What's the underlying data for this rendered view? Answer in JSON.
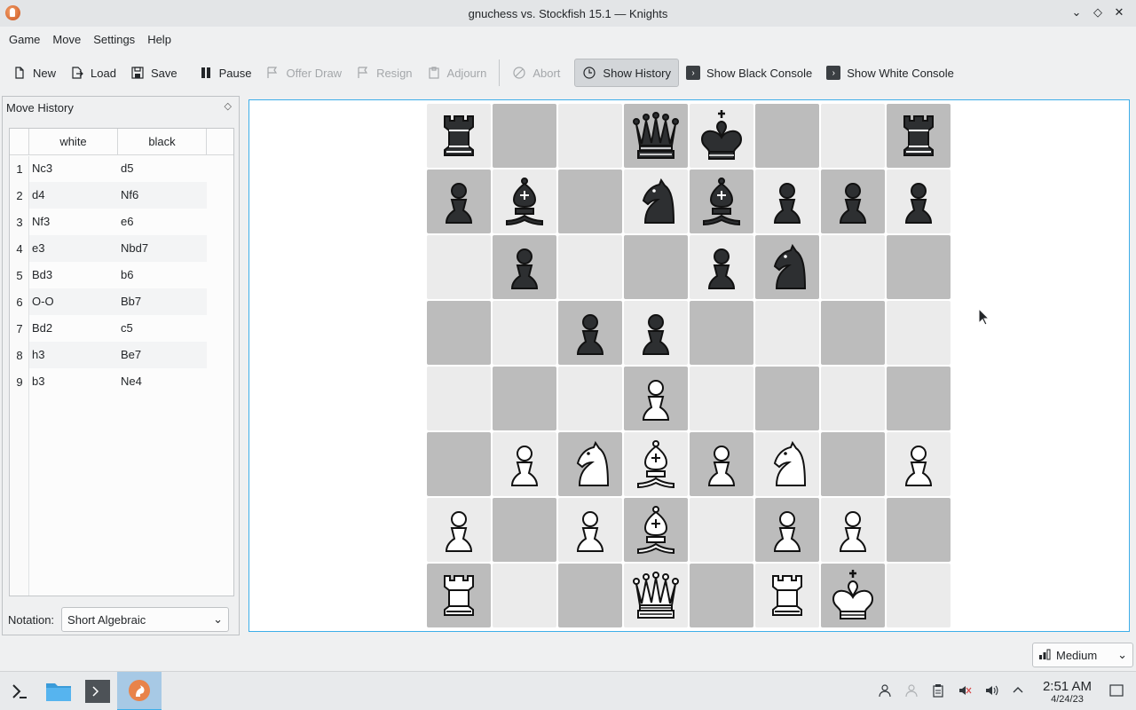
{
  "window": {
    "title": "gnuchess vs. Stockfish 15.1 — Knights"
  },
  "menu": [
    "Game",
    "Move",
    "Settings",
    "Help"
  ],
  "toolbar": {
    "new": "New",
    "load": "Load",
    "save": "Save",
    "pause": "Pause",
    "offer_draw": "Offer Draw",
    "resign": "Resign",
    "adjourn": "Adjourn",
    "abort": "Abort",
    "show_history": "Show History",
    "show_black_console": "Show Black Console",
    "show_white_console": "Show White Console"
  },
  "history": {
    "title": "Move History",
    "col_white": "white",
    "col_black": "black",
    "moves": [
      {
        "n": "1",
        "w": "Nc3",
        "b": "d5"
      },
      {
        "n": "2",
        "w": "d4",
        "b": "Nf6"
      },
      {
        "n": "3",
        "w": "Nf3",
        "b": "e6"
      },
      {
        "n": "4",
        "w": "e3",
        "b": "Nbd7"
      },
      {
        "n": "5",
        "w": "Bd3",
        "b": "b6"
      },
      {
        "n": "6",
        "w": "O-O",
        "b": "Bb7"
      },
      {
        "n": "7",
        "w": "Bd2",
        "b": "c5"
      },
      {
        "n": "8",
        "w": "h3",
        "b": "Be7"
      },
      {
        "n": "9",
        "w": "b3",
        "b": "Ne4"
      }
    ],
    "notation_label": "Notation:",
    "notation_value": "Short Algebraic"
  },
  "board": {
    "rows": [
      [
        "br",
        "",
        "",
        "bq",
        "bk",
        "",
        "",
        "br"
      ],
      [
        "bp",
        "bb",
        "",
        "bn",
        "bb",
        "bp",
        "bp",
        "bp"
      ],
      [
        "",
        "bp",
        "",
        "",
        "bp",
        "bn",
        "",
        ""
      ],
      [
        "",
        "",
        "bp",
        "bp",
        "",
        "",
        "",
        ""
      ],
      [
        "",
        "",
        "",
        "wp",
        "",
        "",
        "",
        ""
      ],
      [
        "",
        "wp",
        "wn",
        "wb",
        "wp",
        "wn",
        "",
        "wp"
      ],
      [
        "wp",
        "",
        "wp",
        "wb",
        "",
        "wp",
        "wp",
        ""
      ],
      [
        "wr",
        "",
        "",
        "wq",
        "",
        "wr",
        "wk",
        ""
      ]
    ],
    "light_color": "#ebebeb",
    "dark_color": "#bcbcbc"
  },
  "difficulty": "Medium",
  "taskbar": {
    "time": "2:51 AM",
    "date": "4/24/23"
  }
}
